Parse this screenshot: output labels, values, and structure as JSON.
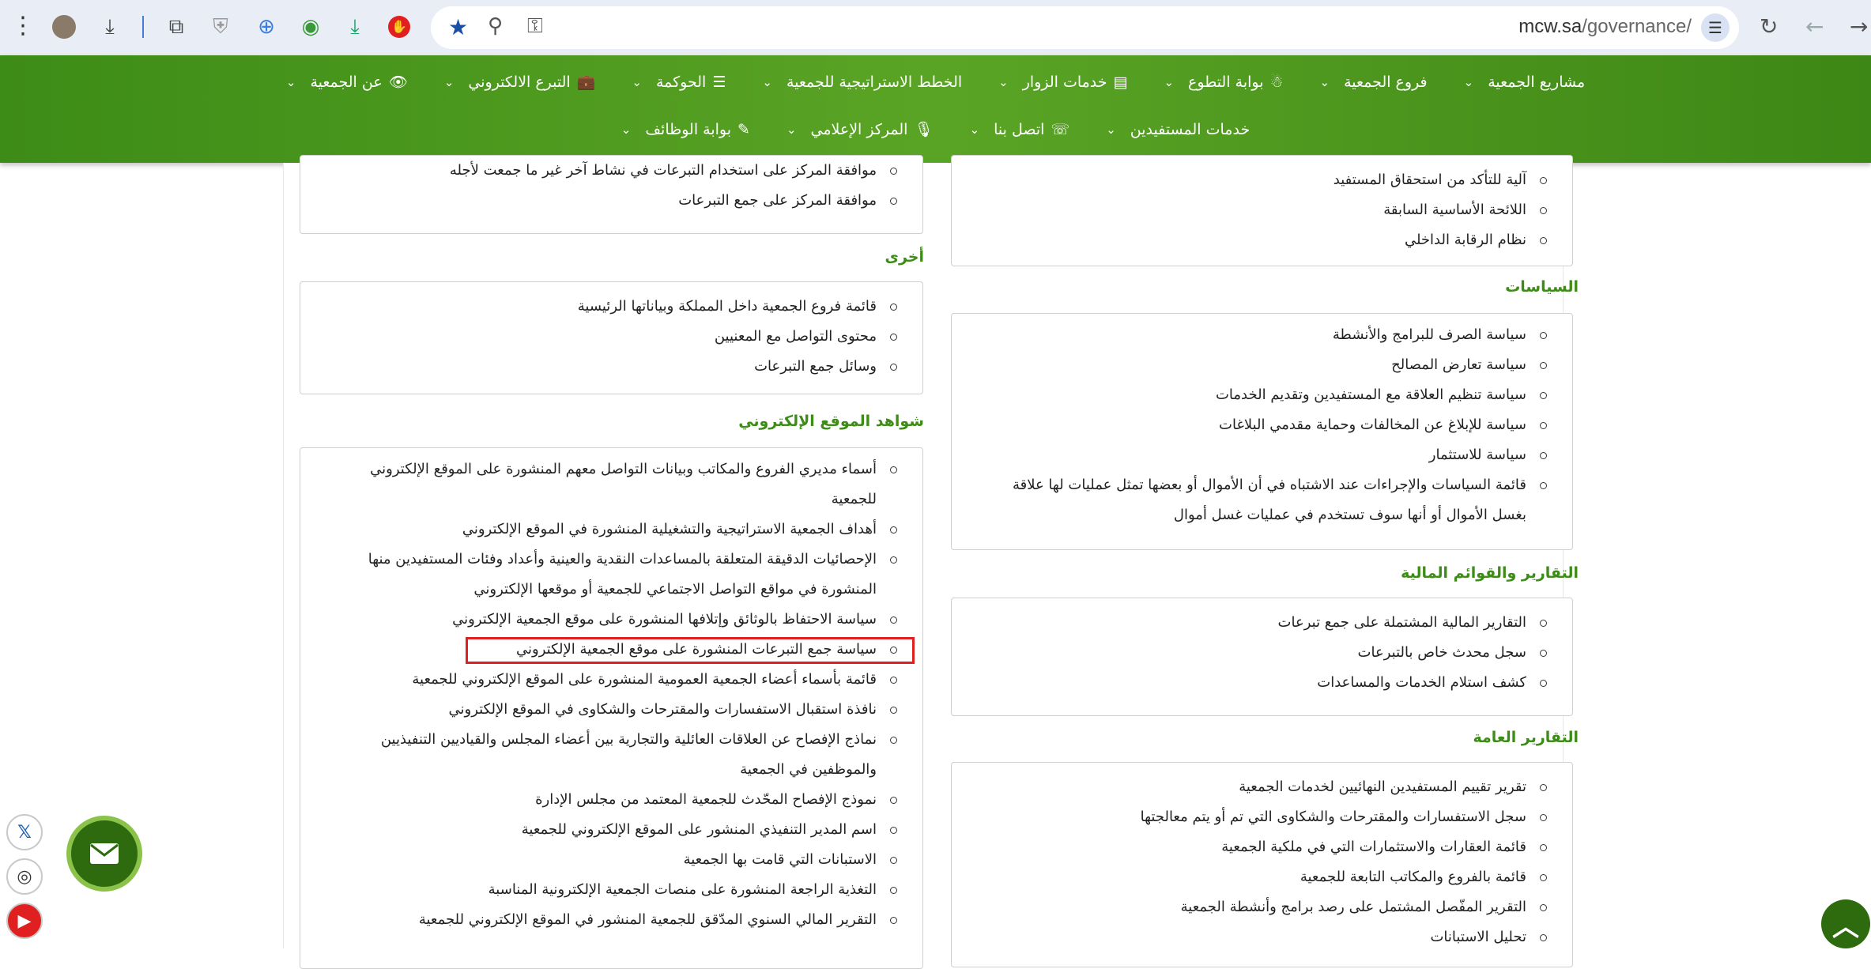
{
  "browser": {
    "url_host": "mcw.sa",
    "url_path": "/governance/"
  },
  "nav": {
    "row1": [
      {
        "label": "عن الجمعية",
        "icon": "eye-icon"
      },
      {
        "label": "التبرع الالكتروني",
        "icon": "briefcase-icon"
      },
      {
        "label": "الحوكمة",
        "icon": "list-icon"
      },
      {
        "label": "الخطط الاستراتيجية للجمعية",
        "icon": ""
      },
      {
        "label": "خدمات الزوار",
        "icon": "server-icon"
      },
      {
        "label": "بوابة التطوع",
        "icon": "person-icon"
      },
      {
        "label": "فروع الجمعية",
        "icon": ""
      },
      {
        "label": "مشاريع الجمعية",
        "icon": ""
      }
    ],
    "row2": [
      {
        "label": "بوابة الوظائف",
        "icon": "edit-icon"
      },
      {
        "label": "المركز الإعلامي",
        "icon": "mic-icon"
      },
      {
        "label": "اتصل بنا",
        "icon": "phone-icon"
      },
      {
        "label": "خدمات المستفيدين",
        "icon": ""
      }
    ]
  },
  "right_col": {
    "top_box": [
      "آلية للتأكد من استحقاق المستفيد",
      "اللائحة الأساسية السابقة",
      "نظام الرقابة الداخلي"
    ],
    "policies_title": "السياسات",
    "policies": [
      "سياسة الصرف للبرامج والأنشطة",
      "سياسة تعارض المصالح",
      "سياسة تنظيم العلاقة مع المستفيدين وتقديم الخدمات",
      "سياسة للإبلاغ عن المخالفات وحماية مقدمي البلاغات",
      "سياسة للاستثمار",
      "قائمة السياسات والإجراءات عند الاشتباه في أن الأموال أو بعضها تمثل عمليات لها علاقة",
      "بغسل الأموال أو أنها سوف تستخدم في عمليات غسل أموال"
    ],
    "financial_title": "التقارير والقوائم المالية",
    "financial": [
      "التقارير المالية المشتملة على جمع تبرعات",
      "سجل محدث خاص بالتبرعات",
      "كشف استلام الخدمات والمساعدات"
    ],
    "general_title": "التقارير العامة",
    "general": [
      "تقرير تقييم المستفيدين النهائيين لخدمات الجمعية",
      "سجل الاستفسارات والمقترحات والشكاوى التي تم أو يتم معالجتها",
      "قائمة العقارات والاستثمارات التي في ملكية الجمعية",
      "قائمة بالفروع والمكاتب التابعة للجمعية",
      "التقرير المفّصل المشتمل على رصد برامج وأنشطة الجمعية",
      "تحليل الاستبانات"
    ]
  },
  "left_col": {
    "top_box": [
      "موافقة المركز على استخدام التبرعات في نشاط آخر غير ما جمعت لأجله",
      "موافقة المركز على جمع التبرعات"
    ],
    "other_title": "أخرى",
    "other": [
      "قائمة فروع الجمعية داخل المملكة وبياناتها الرئيسية",
      "محتوى التواصل مع المعنيين",
      "وسائل جمع التبرعات"
    ],
    "evidence_title": "شواهد الموقع الإلكتروني",
    "evidence": [
      "أسماء مديري الفروع والمكاتب وبيانات التواصل معهم المنشورة على الموقع الإلكتروني",
      "للجمعية",
      "أهداف الجمعية الاستراتيجية والتشغيلية المنشورة في الموقع الإلكتروني",
      "الإحصائيات الدقيقة المتعلقة بالمساعدات النقدية والعينية وأعداد وفئات المستفيدين منها",
      "المنشورة في مواقع التواصل الاجتماعي للجمعية أو موقعها الإلكتروني",
      "سياسة الاحتفاظ بالوثائق وإتلافها المنشورة على موقع الجمعية الإلكتروني",
      "سياسة جمع التبرعات المنشورة على موقع الجمعية الإلكتروني",
      "قائمة بأسماء أعضاء الجمعية العمومية المنشورة على الموقع الإلكتروني للجمعية",
      "نافذة استقبال الاستفسارات والمقترحات والشكاوى في الموقع الإلكتروني",
      "نماذج الإفصاح عن العلاقات العائلية والتجارية بين أعضاء المجلس والقياديين التنفيذيين",
      "والموظفين في الجمعية",
      "نموذج الإفصاح المحّدث للجمعية المعتمد من مجلس الإدارة",
      "اسم المدير التنفيذي المنشور على الموقع الإلكتروني للجمعية",
      "الاستبانات التي قامت بها الجمعية",
      "التغذية الراجعة المنشورة على منصات الجمعية الإلكترونية المناسبة",
      "التقرير المالي السنوي المدّقق للجمعية المنشور في الموقع الإلكتروني للجمعية"
    ]
  },
  "social": [
    "X",
    "instagram",
    "youtube"
  ]
}
